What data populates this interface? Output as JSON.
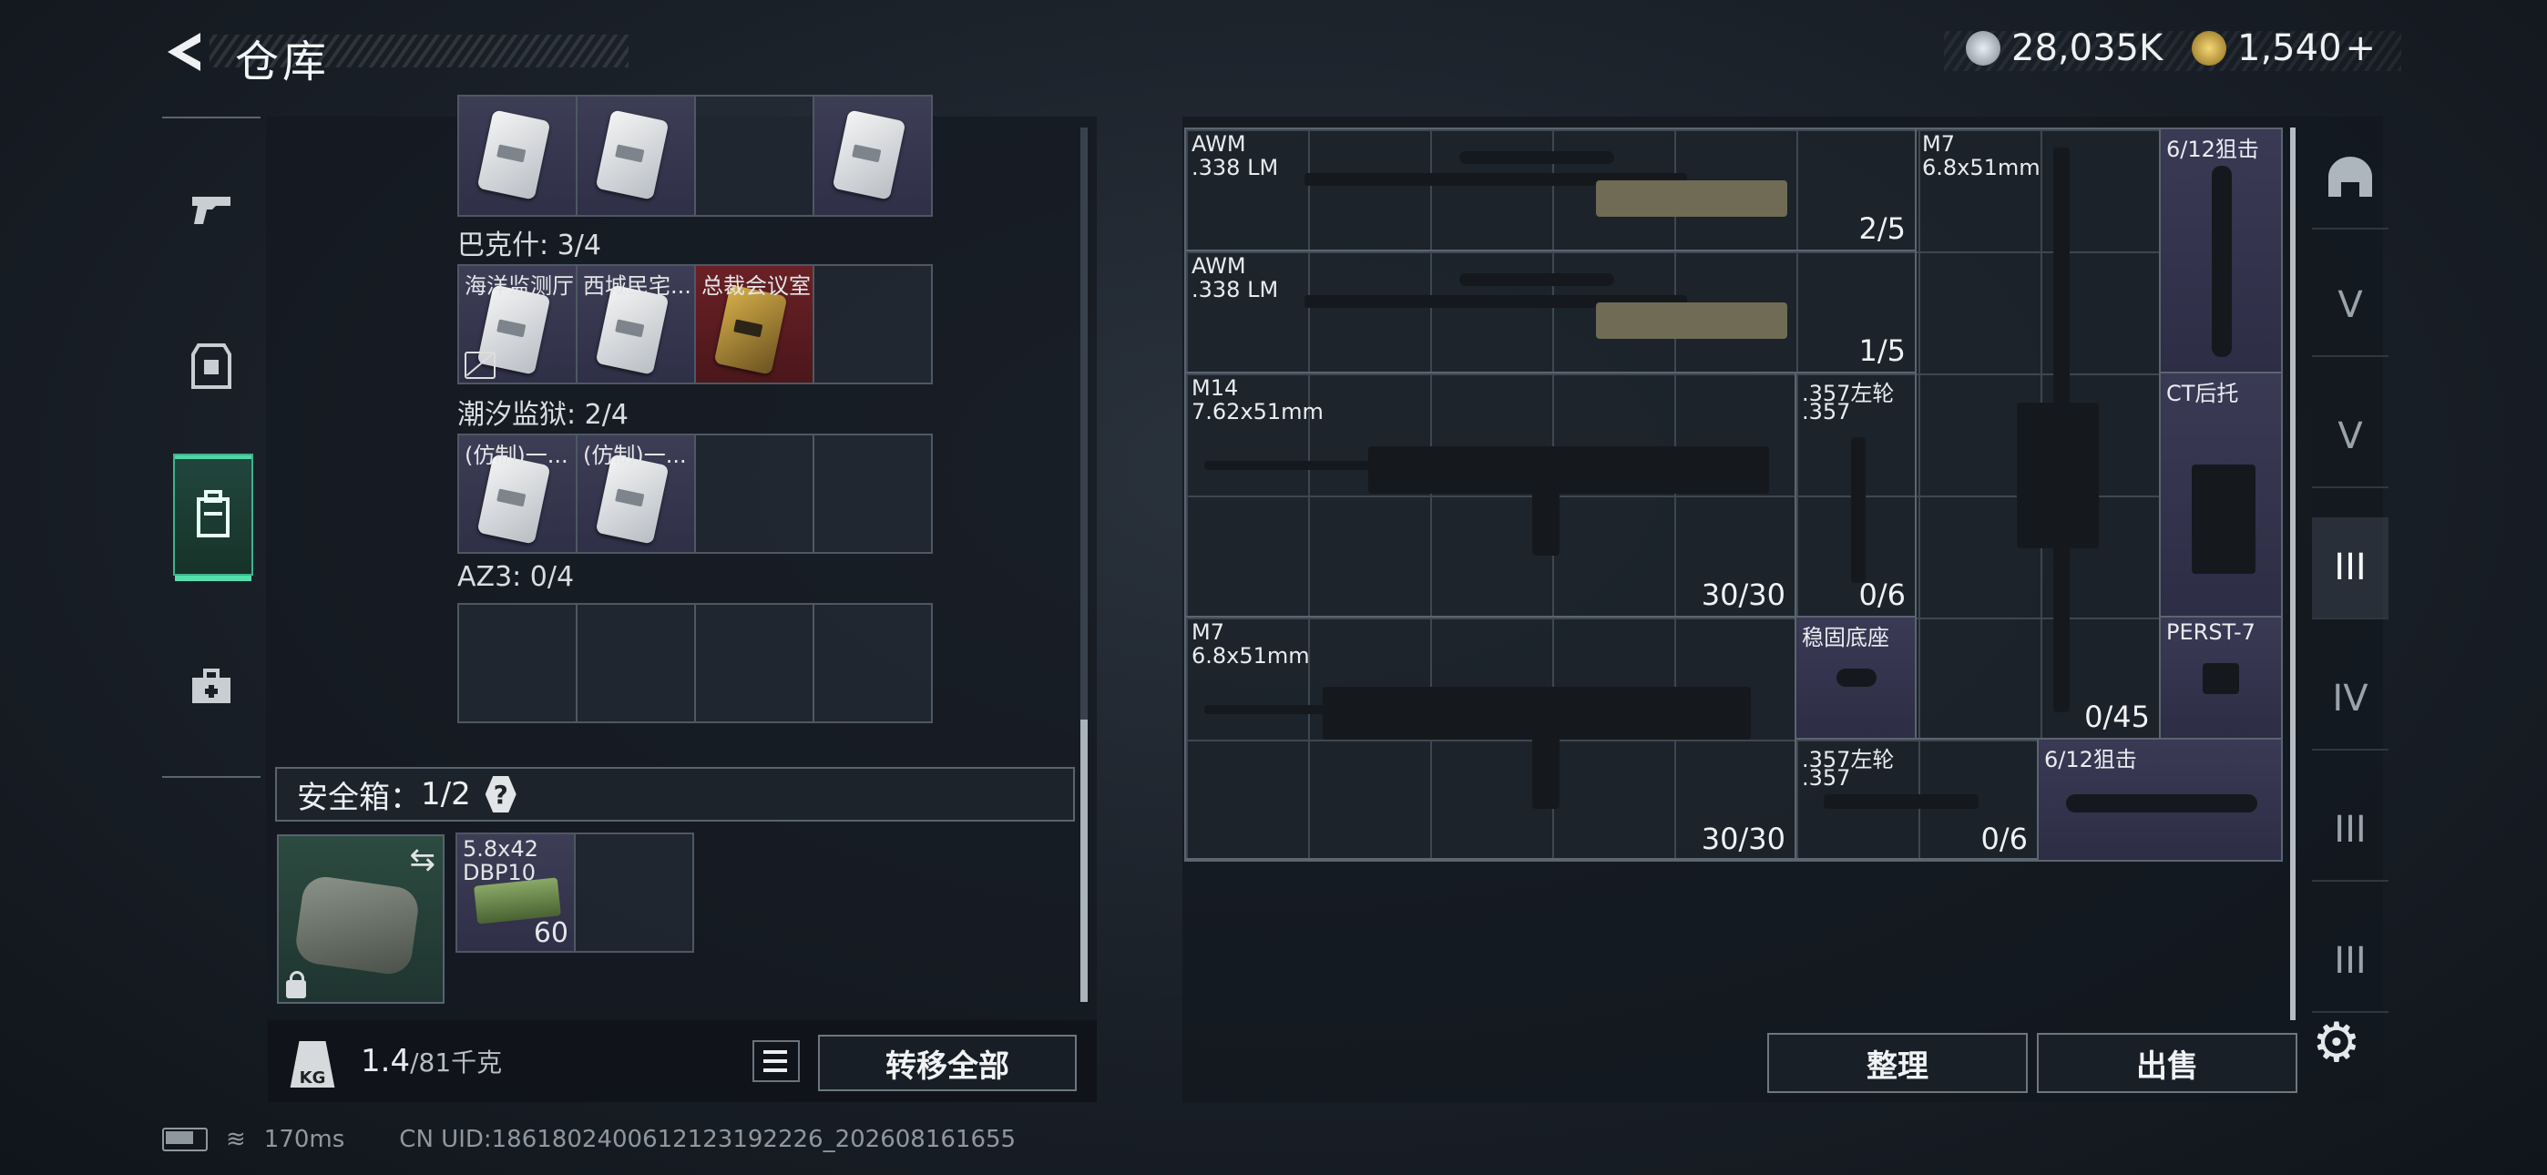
{
  "header": {
    "title": "仓库",
    "back_label": "back"
  },
  "currency": {
    "silver": "28,035K",
    "gold": "1,540",
    "add_label": "+",
    "silver_color": "#b9c2cc",
    "gold_color": "#d6b24a"
  },
  "left_nav": {
    "items": [
      {
        "icon": "pistol-icon",
        "label": ""
      },
      {
        "icon": "armor-icon",
        "label": ""
      },
      {
        "icon": "backpack-icon",
        "label": ""
      },
      {
        "icon": "medkit-icon",
        "label": ""
      }
    ]
  },
  "keycards": {
    "groups": [
      {
        "name": "巴克什: 3/4",
        "slots": [
          "海洋监测厅",
          "西城民宅...",
          "总裁会议室",
          ""
        ]
      },
      {
        "name": "潮汐监狱: 2/4",
        "slots": [
          "(仿制)一...",
          "(仿制)一...",
          "",
          ""
        ]
      },
      {
        "name": "AZ3: 0/4",
        "slots": [
          "",
          "",
          "",
          ""
        ]
      }
    ]
  },
  "safe": {
    "label": "安全箱：",
    "count": "1/2",
    "help": "?",
    "swap_icon": "swap-icon"
  },
  "safe_item": {
    "name_line1": "5.8x42",
    "name_line2": "DBP10",
    "count": "60"
  },
  "weight": {
    "current": "1.4",
    "max": "/81千克",
    "icon_text": "KG"
  },
  "buttons": {
    "transfer_all": "转移全部",
    "organize": "整理",
    "sell": "出售"
  },
  "weapons": [
    {
      "name": "AWM",
      "caliber": ".338 LM",
      "count": "2/5"
    },
    {
      "name": "AWM",
      "caliber": ".338 LM",
      "count": "1/5"
    },
    {
      "name": "M7",
      "caliber": "6.8x51mm",
      "count": "0/45"
    },
    {
      "name": "6/12狙击",
      "caliber": "",
      "count": ""
    },
    {
      "name": "M14",
      "caliber": "7.62x51mm",
      "count": "30/30"
    },
    {
      "name": ".357左轮",
      "caliber": ".357",
      "count": "0/6"
    },
    {
      "name": "CT后托",
      "caliber": "",
      "count": ""
    },
    {
      "name": "M7",
      "caliber": "6.8x51mm",
      "count": "30/30"
    },
    {
      "name": "稳固底座",
      "caliber": "",
      "count": ""
    },
    {
      "name": "PERST-7",
      "caliber": "",
      "count": ""
    },
    {
      "name": ".357左轮",
      "caliber": ".357",
      "count": "0/6"
    },
    {
      "name": "6/12狙击",
      "caliber": "",
      "count": ""
    }
  ],
  "right_nav": {
    "items": [
      {
        "icon": "helmet-icon",
        "label": ""
      },
      {
        "icon": "v-vest-icon",
        "label": "V"
      },
      {
        "icon": "v-vest-icon-2",
        "label": "V"
      },
      {
        "icon": "iii-weapon-icon",
        "label": "III"
      },
      {
        "icon": "iv-folder-icon",
        "label": "IV"
      },
      {
        "icon": "iii-folder-icon",
        "label": "III"
      },
      {
        "icon": "iii-gun-icon",
        "label": "III"
      }
    ]
  },
  "status": {
    "ping": "170ms",
    "uid": "CN UID:1861802400612123192226_202608161655"
  }
}
